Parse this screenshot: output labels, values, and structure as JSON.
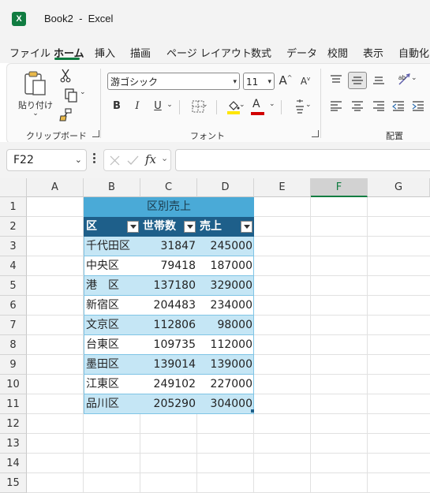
{
  "window": {
    "title": "Book2  -  Excel",
    "logo": "X"
  },
  "menu": {
    "tabs": [
      "ファイル",
      "ホーム",
      "挿入",
      "描画",
      "ページ レイアウト",
      "数式",
      "データ",
      "校閲",
      "表示",
      "自動化"
    ],
    "active": "ホーム"
  },
  "ribbon": {
    "clipboard": {
      "paste_label": "貼り付け",
      "group_label": "クリップボード"
    },
    "font": {
      "name": "游ゴシック",
      "size": "11",
      "group_label": "フォント",
      "grow": "A",
      "shrink": "A",
      "bold": "B",
      "italic": "I",
      "underline": "U",
      "font_color_letter": "A",
      "highlight_color": "#ffe600",
      "font_color": "#d10000"
    },
    "alignment": {
      "group_label": "配置"
    }
  },
  "formula_bar": {
    "name_box": "F22",
    "fx": "fx",
    "formula": ""
  },
  "sheet": {
    "columns": [
      "A",
      "B",
      "C",
      "D",
      "E",
      "F",
      "G"
    ],
    "selected_column": "F",
    "rows": [
      "1",
      "2",
      "3",
      "4",
      "5",
      "6",
      "7",
      "8",
      "9",
      "10",
      "11",
      "12",
      "13",
      "14",
      "15"
    ],
    "table": {
      "title": "区別売上",
      "headers": [
        "区",
        "世帯数",
        "売上"
      ],
      "rows": [
        [
          "千代田区",
          "31847",
          "245000"
        ],
        [
          "中央区",
          "79418",
          "187000"
        ],
        [
          "港　区",
          "137180",
          "329000"
        ],
        [
          "新宿区",
          "204483",
          "234000"
        ],
        [
          "文京区",
          "112806",
          "98000"
        ],
        [
          "台東区",
          "109735",
          "112000"
        ],
        [
          "墨田区",
          "139014",
          "139000"
        ],
        [
          "江東区",
          "249102",
          "227000"
        ],
        [
          "品川区",
          "205290",
          "304000"
        ]
      ],
      "band_color": "#c5e6f5",
      "header_color": "#1e5f8a",
      "title_color": "#4aaad7"
    }
  }
}
